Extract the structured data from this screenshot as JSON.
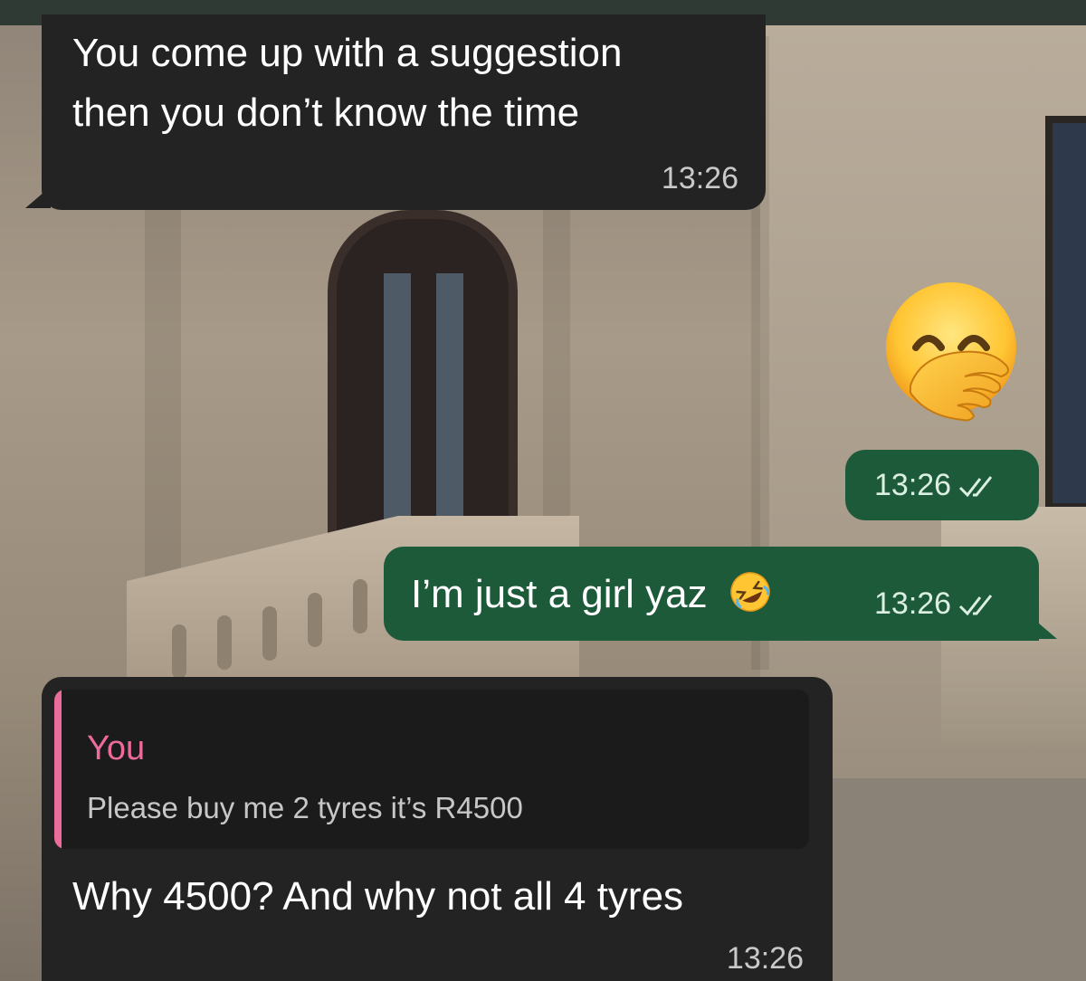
{
  "messages": [
    {
      "direction": "incoming",
      "lines": [
        "You come up with a suggestion",
        "then you don’t know the time"
      ],
      "time": "13:26"
    },
    {
      "direction": "outgoing",
      "type": "emoji",
      "emoji_icon": "face-with-hand-over-mouth-icon",
      "time": "13:26",
      "status_icon": "double-check-icon"
    },
    {
      "direction": "outgoing",
      "text": "I’m just a girl yaz",
      "trailing_emoji_icon": "rolling-on-floor-laughing-icon",
      "time": "13:26",
      "status_icon": "double-check-icon"
    },
    {
      "direction": "incoming",
      "quote": {
        "author": "You",
        "text": "Please buy me 2 tyres it’s R4500"
      },
      "text": "Why 4500? And why not all 4 tyres",
      "time": "13:26"
    }
  ],
  "colors": {
    "incoming_bubble": "#232323",
    "outgoing_bubble": "#1d5a3a",
    "quote_accent": "#ec6b9a"
  }
}
